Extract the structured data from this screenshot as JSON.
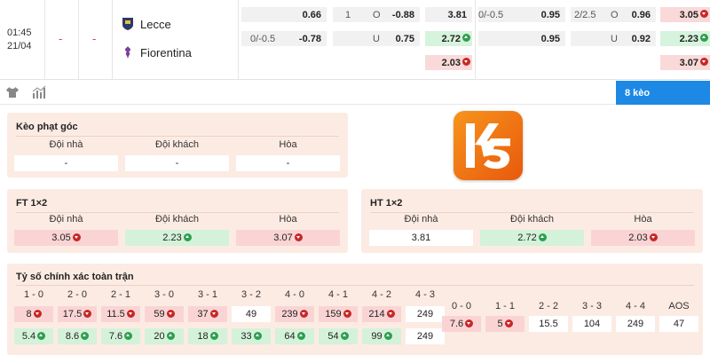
{
  "match": {
    "time": "01:45",
    "date": "21/04",
    "home_score": "-",
    "away_score": "-",
    "home_team": "Lecce",
    "away_team": "Fiorentina"
  },
  "odds_rows": [
    {
      "c1_left": "",
      "c1_val": "0.66",
      "c2_left": "1",
      "c2_mid": "O",
      "c2_val": "-0.88",
      "c3_val": "3.81",
      "c4_left": "0/-0.5",
      "c4_val": "0.95",
      "c5_left": "2/2.5",
      "c5_mid": "O",
      "c5_val": "0.96",
      "c6_val": "3.05"
    },
    {
      "c1_left": "0/-0.5",
      "c1_val": "-0.78",
      "c2_left": "",
      "c2_mid": "U",
      "c2_val": "0.75",
      "c3_val": "2.72",
      "c4_left": "",
      "c4_val": "0.95",
      "c5_left": "",
      "c5_mid": "U",
      "c5_val": "0.92",
      "c6_val": "2.23"
    },
    {
      "c3_val": "2.03",
      "c6_val": "3.07"
    }
  ],
  "toolbar": {
    "keo_label": "8 kèo"
  },
  "corner": {
    "title": "Kèo phạt góc",
    "h1": "Đội nhà",
    "h2": "Đội khách",
    "h3": "Hòa",
    "v1": "-",
    "v2": "-",
    "v3": "-"
  },
  "ft": {
    "title": "FT 1×2",
    "h1": "Đội nhà",
    "h2": "Đội khách",
    "h3": "Hòa",
    "v1": "3.05",
    "v2": "2.23",
    "v3": "3.07"
  },
  "ht": {
    "title": "HT 1×2",
    "h1": "Đội nhà",
    "h2": "Đội khách",
    "h3": "Hòa",
    "v1": "3.81",
    "v2": "2.72",
    "v3": "2.03"
  },
  "exact": {
    "title": "Tỷ số chính xác toàn trận",
    "left_headers": [
      "1 - 0",
      "2 - 0",
      "2 - 1",
      "3 - 0",
      "3 - 1",
      "3 - 2",
      "4 - 0",
      "4 - 1",
      "4 - 2",
      "4 - 3"
    ],
    "left_row1": [
      "8",
      "17.5",
      "11.5",
      "59",
      "37",
      "49",
      "239",
      "159",
      "214",
      "249"
    ],
    "left_row2": [
      "5.4",
      "8.6",
      "7.6",
      "20",
      "18",
      "33",
      "64",
      "54",
      "99",
      "249"
    ],
    "right_headers": [
      "0 - 0",
      "1 - 1",
      "2 - 2",
      "3 - 3",
      "4 - 4",
      "AOS"
    ],
    "right_row1": [
      "7.6",
      "5",
      "15.5",
      "104",
      "249",
      "47"
    ]
  },
  "colors": {
    "accent": "#1e88e5",
    "panel_bg": "#fcebe3",
    "red_cell": "#fad4d4",
    "green_cell": "#d4f2da",
    "logo_orange": "#f7941d"
  }
}
